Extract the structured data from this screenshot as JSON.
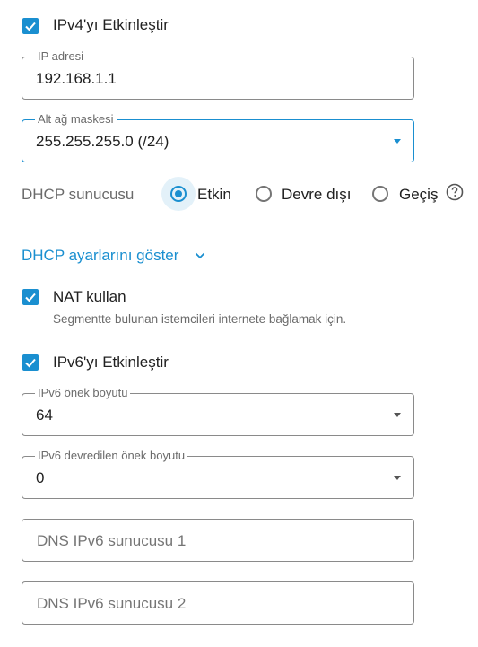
{
  "ipv4": {
    "enable_label": "IPv4'yı Etkinleştir",
    "enabled": true,
    "ip_field": {
      "label": "IP adresi",
      "value": "192.168.1.1"
    },
    "mask_field": {
      "label": "Alt ağ maskesi",
      "value": "255.255.255.0 (/24)"
    },
    "dhcp": {
      "label": "DHCP sunucusu",
      "options": [
        "Etkin",
        "Devre dışı",
        "Geçiş"
      ],
      "selected": "Etkin"
    },
    "dhcp_settings_link": "DHCP ayarlarını göster",
    "nat": {
      "label": "NAT kullan",
      "enabled": true,
      "description": "Segmentte bulunan istemcileri internete bağlamak için."
    }
  },
  "ipv6": {
    "enable_label": "IPv6'yı Etkinleştir",
    "enabled": true,
    "prefix_field": {
      "label": "IPv6 önek boyutu",
      "value": "64"
    },
    "delegated_field": {
      "label": "IPv6 devredilen önek boyutu",
      "value": "0"
    },
    "dns1_placeholder": "DNS IPv6 sunucusu 1",
    "dns2_placeholder": "DNS IPv6 sunucusu 2"
  },
  "colors": {
    "accent": "#1a8fd0",
    "border": "#8a8a8a",
    "label": "#6b6b6b"
  },
  "icons": {
    "checkbox": "check-icon",
    "help": "help-circle-icon",
    "dropdown": "caret-down-icon",
    "expand": "chevron-down-icon"
  }
}
